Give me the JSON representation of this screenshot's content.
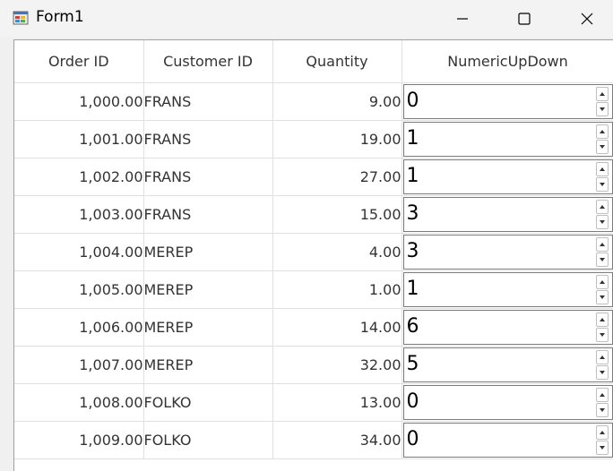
{
  "window": {
    "title": "Form1",
    "minimize_icon": "minimize-icon",
    "maximize_icon": "maximize-icon",
    "close_icon": "close-icon"
  },
  "grid": {
    "columns": [
      "Order ID",
      "Customer ID",
      "Quantity",
      "NumericUpDown"
    ],
    "rows": [
      {
        "order_id": "1,000.00",
        "customer_id": "FRANS",
        "quantity": "9.00",
        "numeric": "0"
      },
      {
        "order_id": "1,001.00",
        "customer_id": "FRANS",
        "quantity": "19.00",
        "numeric": "1"
      },
      {
        "order_id": "1,002.00",
        "customer_id": "FRANS",
        "quantity": "27.00",
        "numeric": "1"
      },
      {
        "order_id": "1,003.00",
        "customer_id": "FRANS",
        "quantity": "15.00",
        "numeric": "3"
      },
      {
        "order_id": "1,004.00",
        "customer_id": "MEREP",
        "quantity": "4.00",
        "numeric": "3"
      },
      {
        "order_id": "1,005.00",
        "customer_id": "MEREP",
        "quantity": "1.00",
        "numeric": "1"
      },
      {
        "order_id": "1,006.00",
        "customer_id": "MEREP",
        "quantity": "14.00",
        "numeric": "6"
      },
      {
        "order_id": "1,007.00",
        "customer_id": "MEREP",
        "quantity": "32.00",
        "numeric": "5"
      },
      {
        "order_id": "1,008.00",
        "customer_id": "FOLKO",
        "quantity": "13.00",
        "numeric": "0"
      },
      {
        "order_id": "1,009.00",
        "customer_id": "FOLKO",
        "quantity": "34.00",
        "numeric": "0"
      }
    ]
  }
}
